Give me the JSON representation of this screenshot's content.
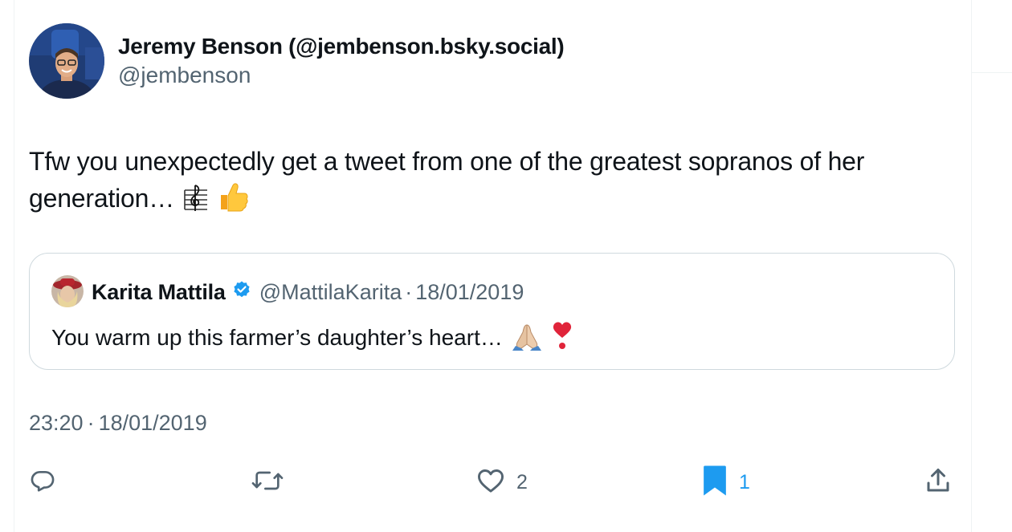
{
  "tweet": {
    "author": {
      "name": "Jeremy Benson (@jembenson.bsky.social)",
      "handle": "@jembenson"
    },
    "text": "Tfw you unexpectedly get a tweet from one of the greatest sopranos of her generation…",
    "text_emojis": [
      "musical-score",
      "thumbs-up"
    ],
    "quoted": {
      "name": "Karita Mattila",
      "verified": true,
      "handle": "@MattilaKarita",
      "separator": "·",
      "date": "18/01/2019",
      "text": "You warm up this farmer’s daughter’s heart…",
      "text_emojis": [
        "folded-hands",
        "heavy-heart-exclamation"
      ]
    },
    "timestamp": {
      "time": "23:20",
      "separator": "·",
      "date": "18/01/2019"
    },
    "actions": {
      "reply": {
        "icon": "reply-icon",
        "count": ""
      },
      "retweet": {
        "icon": "retweet-icon",
        "count": ""
      },
      "like": {
        "icon": "heart-icon",
        "count": "2"
      },
      "bookmark": {
        "icon": "bookmark-icon",
        "count": "1",
        "active": true
      },
      "share": {
        "icon": "share-icon",
        "count": ""
      }
    }
  },
  "colors": {
    "text_primary": "#0f1419",
    "text_secondary": "#536471",
    "accent": "#1d9bf0",
    "border": "#cfd9de"
  }
}
